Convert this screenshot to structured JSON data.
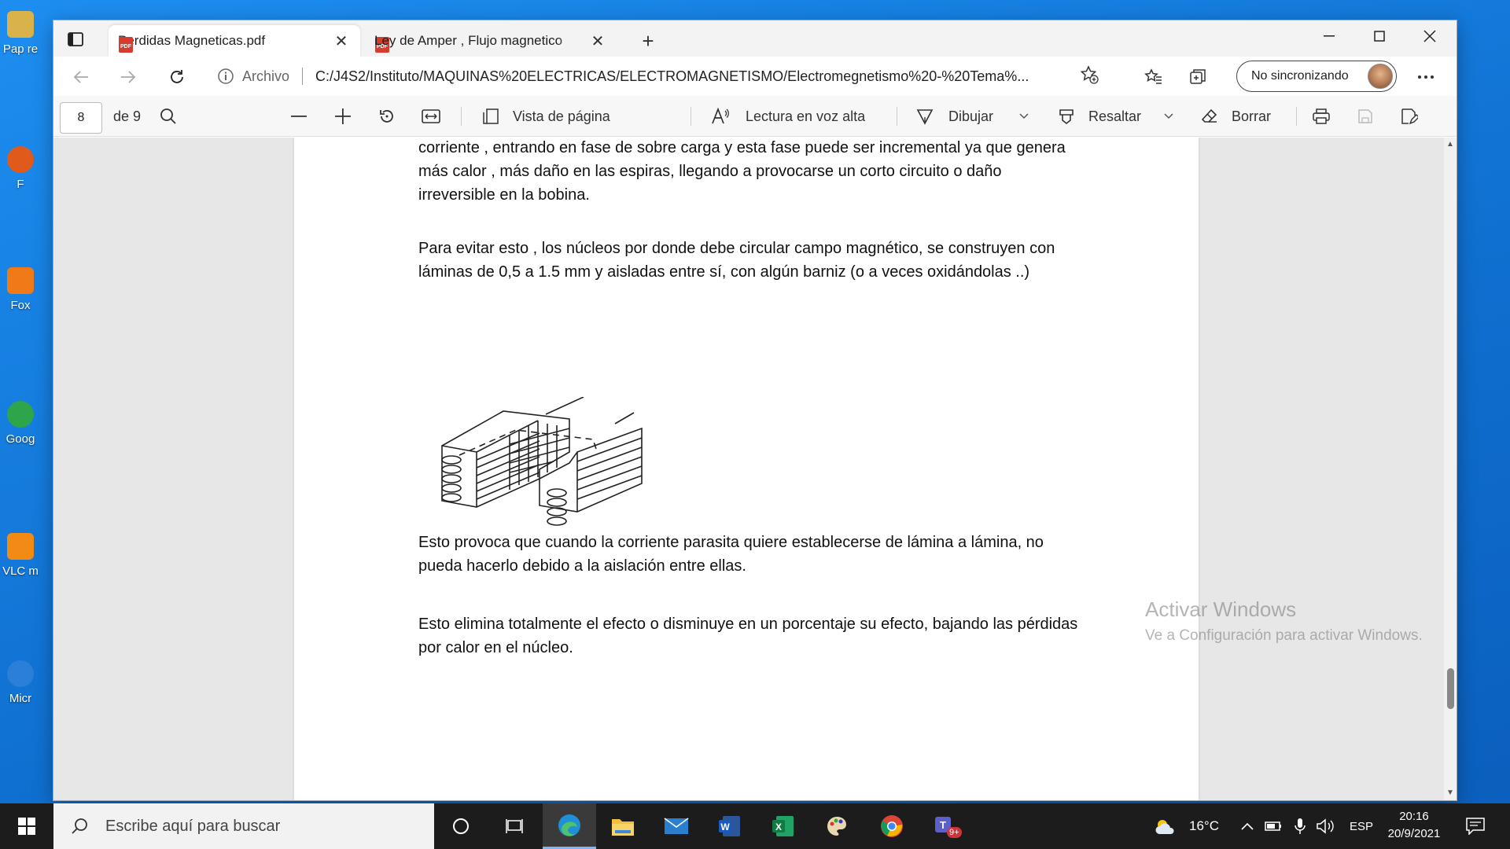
{
  "desktop": {
    "icons": [
      {
        "label": "Pap re",
        "color": "#d9b24a"
      },
      {
        "label": "F",
        "color": "#e05a1c"
      },
      {
        "label": "Fox",
        "color": "#f07a18"
      },
      {
        "label": "Goog",
        "color": "#2ea54a"
      },
      {
        "label": "VLC m",
        "color": "#f28a14"
      },
      {
        "label": "Micr",
        "color": "#2a7fd6"
      }
    ]
  },
  "browser": {
    "tabs": [
      {
        "title": "Perdidas Magneticas.pdf",
        "active": true
      },
      {
        "title": "Ley de Amper , Flujo magnetico",
        "active": false
      }
    ],
    "address": {
      "scheme_label": "Archivo",
      "url": "C:/J4S2/Instituto/MAQUINAS%20ELECTRICAS/ELECTROMAGNETISMO/Electromegnetismo%20-%20Tema%..."
    },
    "profile_label": "No sincronizando"
  },
  "pdf_toolbar": {
    "page_current": "8",
    "page_total": "de 9",
    "page_view_label": "Vista de página",
    "read_aloud_label": "Lectura en voz alta",
    "draw_label": "Dibujar",
    "highlight_label": "Resaltar",
    "erase_label": "Borrar"
  },
  "document": {
    "paragraphs": [
      "corriente , entrando en fase de sobre carga y esta fase puede ser incremental ya que genera más calor , más daño en las espiras,  llegando a provocarse un corto circuito o daño irreversible en la bobina.",
      "Para evitar esto , los núcleos por donde debe circular campo magnético, se construyen con láminas de 0,5 a 1.5 mm y aisladas entre sí, con algún barniz (o a veces oxidándolas ..)",
      "Esto provoca que cuando la corriente parasita quiere establecerse de lámina a lámina, no pueda hacerlo debido a la aislación entre ellas.",
      "Esto elimina totalmente el efecto o disminuye en un porcentaje su efecto, bajando las pérdidas por calor en el núcleo."
    ]
  },
  "watermark": {
    "line1": "Activar Windows",
    "line2": "Ve a Configuración para activar Windows."
  },
  "taskbar": {
    "search_placeholder": "Escribe aquí para buscar",
    "weather": "16°C",
    "language": "ESP",
    "time": "20:16",
    "date": "20/9/2021",
    "teams_badge": "9+"
  }
}
